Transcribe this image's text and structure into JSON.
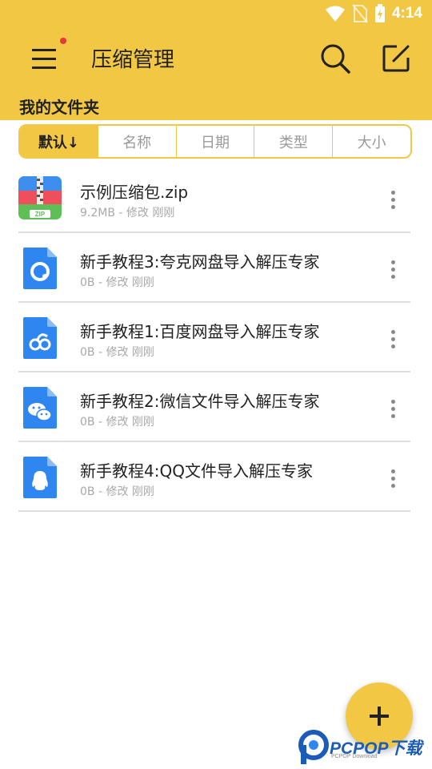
{
  "status_bar": {
    "time": "4:14"
  },
  "app_bar": {
    "title": "压缩管理"
  },
  "folder": {
    "title": "我的文件夹"
  },
  "sort_tabs": [
    {
      "label": "默认↓",
      "active": true
    },
    {
      "label": "名称",
      "active": false
    },
    {
      "label": "日期",
      "active": false
    },
    {
      "label": "类型",
      "active": false
    },
    {
      "label": "大小",
      "active": false
    }
  ],
  "files": [
    {
      "name": "示例压缩包.zip",
      "meta": "9.2MB - 修改 刚刚",
      "icon": "zip-file-icon"
    },
    {
      "name": "新手教程3:夸克网盘导入解压专家",
      "meta": "0B - 修改 刚刚",
      "icon": "quark-doc-icon"
    },
    {
      "name": "新手教程1:百度网盘导入解压专家",
      "meta": "0B - 修改 刚刚",
      "icon": "baidu-doc-icon"
    },
    {
      "name": "新手教程2:微信文件导入解压专家",
      "meta": "0B - 修改 刚刚",
      "icon": "wechat-doc-icon"
    },
    {
      "name": "新手教程4:QQ文件导入解压专家",
      "meta": "0B - 修改 刚刚",
      "icon": "qq-doc-icon"
    }
  ],
  "zip_icon_label": "ZIP",
  "watermark": {
    "text": "PCPOP下载",
    "sub": "PCPOP Download"
  },
  "colors": {
    "accent": "#f2c744",
    "icon_blue": "#2f86f0",
    "notification_dot": "#e53935"
  }
}
